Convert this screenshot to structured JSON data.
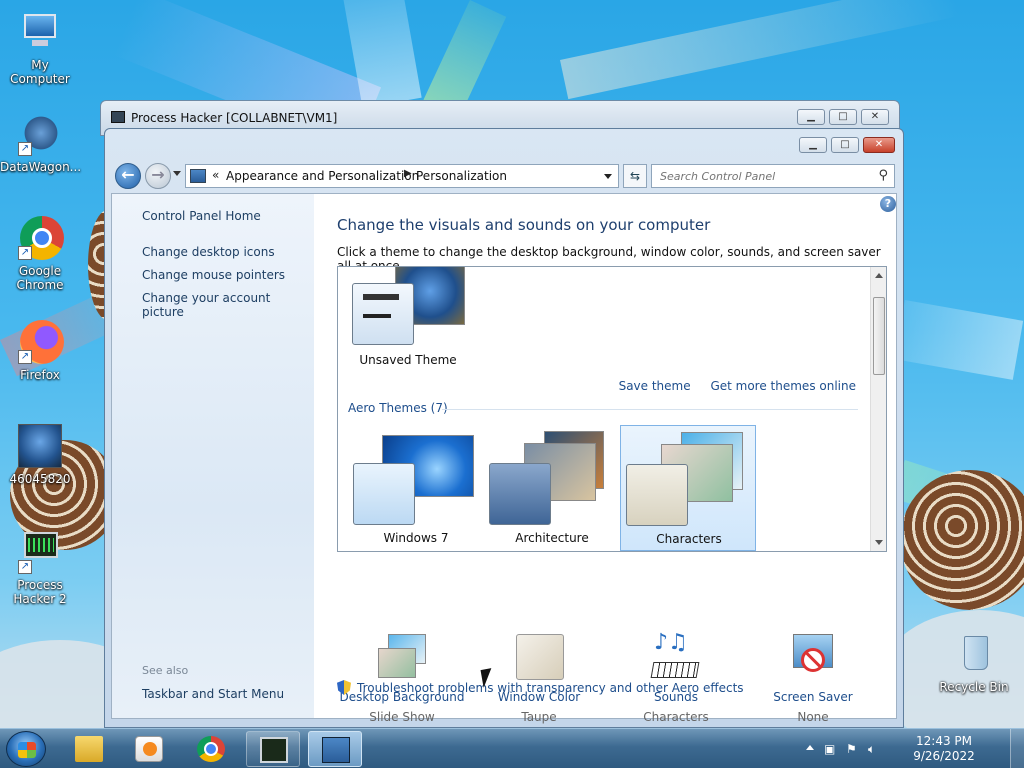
{
  "desktop": {
    "icons": [
      {
        "label": "My Computer"
      },
      {
        "label": "DataWagon..."
      },
      {
        "label": "Google Chrome"
      },
      {
        "label": "Firefox"
      },
      {
        "label": "46045820"
      },
      {
        "label": "Process Hacker 2"
      },
      {
        "label": "Recycle Bin"
      }
    ]
  },
  "bg_window": {
    "title": "Process Hacker [COLLABNET\\VM1]"
  },
  "window": {
    "address": {
      "chevron": "«",
      "crumb1": "Appearance and Personalization",
      "crumb2": "Personalization"
    },
    "search": {
      "placeholder": "Search Control Panel"
    },
    "left_pane": {
      "home": "Control Panel Home",
      "links": [
        "Change desktop icons",
        "Change mouse pointers",
        "Change your account picture"
      ],
      "see_also": "See also",
      "see_also_links": [
        "Taskbar and Start Menu"
      ]
    },
    "main": {
      "heading": "Change the visuals and sounds on your computer",
      "subheading": "Click a theme to change the desktop background, window color, sounds, and screen saver all at once.",
      "my_themes": [
        {
          "name": "Unsaved Theme"
        }
      ],
      "save_theme": "Save theme",
      "get_more": "Get more themes online",
      "aero_group": "Aero Themes (7)",
      "aero_themes": [
        {
          "name": "Windows 7"
        },
        {
          "name": "Architecture"
        },
        {
          "name": "Characters",
          "selected": true
        }
      ],
      "settings": [
        {
          "label": "Desktop Background",
          "value": "Slide Show"
        },
        {
          "label": "Window Color",
          "value": "Taupe"
        },
        {
          "label": "Sounds",
          "value": "Characters"
        },
        {
          "label": "Screen Saver",
          "value": "None"
        }
      ],
      "troubleshoot": "Troubleshoot problems with transparency and other Aero effects"
    }
  },
  "taskbar": {
    "clock_time": "12:43 PM",
    "clock_date": "9/26/2022"
  },
  "colors": {
    "link": "#1e4e8c",
    "heading": "#1e3f6e",
    "desktop_sky": "#2aa6e6"
  }
}
